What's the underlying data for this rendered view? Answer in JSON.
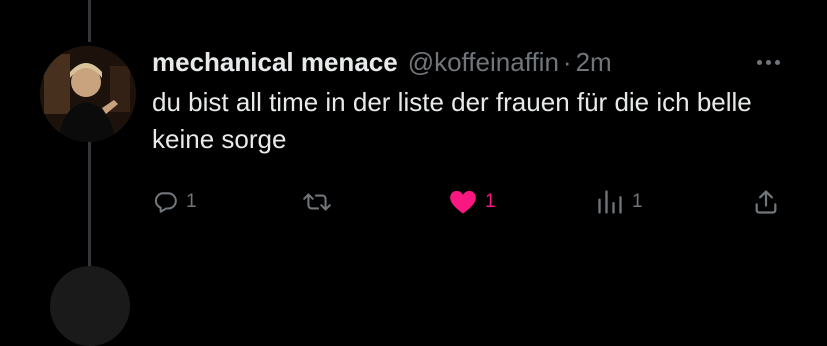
{
  "tweet": {
    "display_name": "mechanical menace",
    "handle": "@koffeinaffin",
    "separator": "·",
    "time": "2m",
    "text": "du bist all time in der liste der frauen für die ich belle keine sorge"
  },
  "actions": {
    "reply": {
      "icon": "reply-icon",
      "count": "1"
    },
    "retweet": {
      "icon": "retweet-icon",
      "count": ""
    },
    "like": {
      "icon": "heart-filled-icon",
      "count": "1",
      "liked": true
    },
    "views": {
      "icon": "analytics-icon",
      "count": "1"
    },
    "share": {
      "icon": "share-icon"
    }
  },
  "more_menu": {
    "icon": "more-dots-icon"
  },
  "colors": {
    "background": "#000000",
    "text_primary": "#e7e9ea",
    "text_secondary": "#71767b",
    "like_pink": "#f91880",
    "thread_line": "#333639"
  }
}
